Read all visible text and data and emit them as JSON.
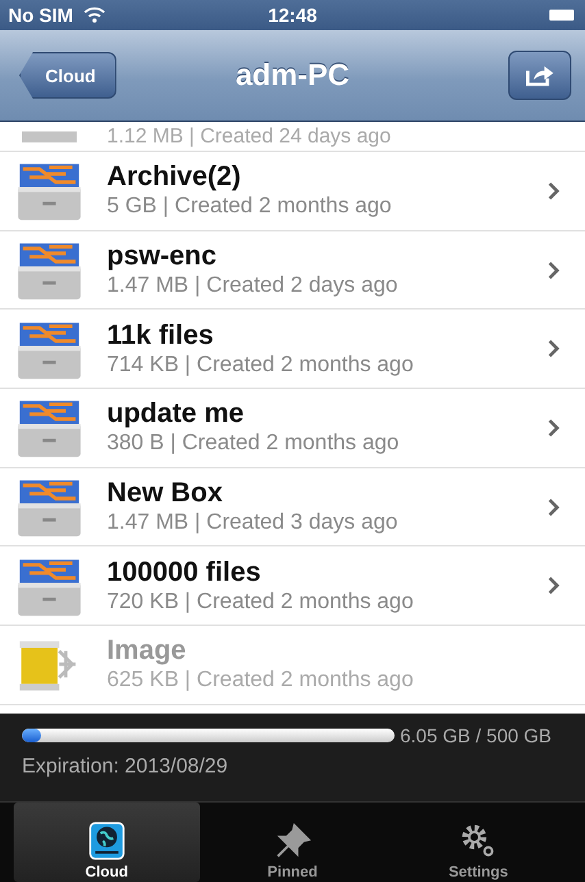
{
  "status_bar": {
    "carrier": "No SIM",
    "time": "12:48"
  },
  "nav": {
    "back": "Cloud",
    "title": "adm-PC"
  },
  "partial_row": {
    "subtitle": "1.12 MB | Created 24 days ago"
  },
  "items": [
    {
      "kind": "box",
      "name": "Archive(2)",
      "subtitle": "5 GB | Created 2 months ago",
      "disabled": false
    },
    {
      "kind": "box",
      "name": "psw-enc",
      "subtitle": "1.47 MB | Created 2 days ago",
      "disabled": false
    },
    {
      "kind": "box",
      "name": "11k files",
      "subtitle": "714 KB | Created 2 months ago",
      "disabled": false
    },
    {
      "kind": "box",
      "name": "update me",
      "subtitle": "380 B | Created 2 months ago",
      "disabled": false
    },
    {
      "kind": "box",
      "name": "New Box",
      "subtitle": "1.47 MB | Created 3 days ago",
      "disabled": false
    },
    {
      "kind": "box",
      "name": "100000 files",
      "subtitle": "720 KB | Created 2 months ago",
      "disabled": false
    },
    {
      "kind": "image",
      "name": "Image",
      "subtitle": "625 KB | Created 2 months ago",
      "disabled": true
    }
  ],
  "storage": {
    "level": 0.012,
    "reading": "6.05 GB / 500 GB",
    "expiration": "Expiration: 2013/08/29"
  },
  "tabs": [
    {
      "kind": "cloud",
      "label": "Cloud",
      "selected": true
    },
    {
      "kind": "pin",
      "label": "Pinned",
      "selected": false
    },
    {
      "kind": "settings",
      "label": "Settings",
      "selected": false
    }
  ]
}
